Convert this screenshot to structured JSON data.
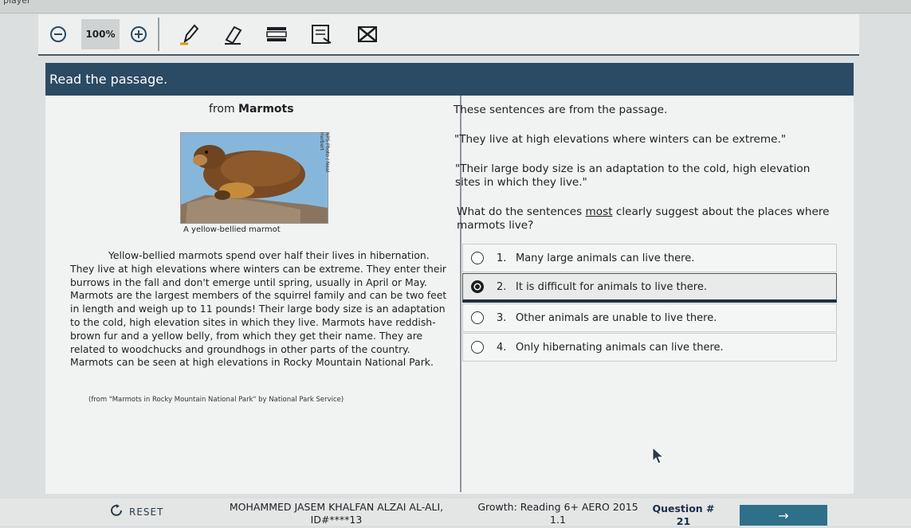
{
  "app": {
    "title_fragment": "player"
  },
  "toolbar": {
    "zoom_level": "100%",
    "tools": [
      "zoom-out",
      "zoom-in",
      "highlighter",
      "eraser",
      "line-reader",
      "notepad",
      "strikethrough"
    ]
  },
  "header": {
    "instruction": "Read the passage."
  },
  "passage": {
    "title_prefix": "from",
    "title": "Marmots",
    "photo_credit": "NPS Photo / Neal Herbert",
    "caption": "A yellow-bellied marmot",
    "body": "Yellow-bellied marmots spend over half their lives in hibernation. They live at high elevations where winters can be extreme. They enter their burrows in the fall and don't emerge until spring, usually in April or May. Marmots are the largest members of the squirrel family and can be two feet in length and weigh up to 11 pounds! Their large body size is an adaptation to the cold, high elevation sites in which they live. Marmots have reddish-brown fur and a yellow belly, from which they get their name. They are related to woodchucks and groundhogs in other parts of the country. Marmots can be seen at high elevations in Rocky Mountain National Park.",
    "citation": "(from \"Marmots in Rocky Mountain National Park\" by National Park Service)"
  },
  "question": {
    "intro": "These sentences are from the passage.",
    "quote1": "\"They live at high elevations where winters can be extreme.\"",
    "quote2": "\"Their large body size is an adaptation to the cold, high elevation sites in which they live.\"",
    "stem_before": "What do the sentences ",
    "stem_emphasis": "most",
    "stem_after": " clearly suggest about the places where marmots live?",
    "choices": [
      {
        "num": "1.",
        "text": "Many large animals can live there.",
        "selected": false
      },
      {
        "num": "2.",
        "text": "It is difficult for animals to live there.",
        "selected": true
      },
      {
        "num": "3.",
        "text": "Other animals are unable to live there.",
        "selected": false
      },
      {
        "num": "4.",
        "text": "Only hibernating animals can live there.",
        "selected": false
      }
    ]
  },
  "footer": {
    "reset_label": "RESET",
    "student_name": "MOHAMMED JASEM KHALFAN ALZAI AL-ALI,",
    "student_id": "ID#****13",
    "test_name": "Growth: Reading 6+ AERO 2015",
    "test_version": "1.1",
    "question_label": "Question #",
    "question_number": "21",
    "next_label": "→"
  },
  "colors": {
    "header_bg": "#2b4a63",
    "next_bg": "#2e6f8a",
    "selected_border": "#1e2f3d"
  }
}
